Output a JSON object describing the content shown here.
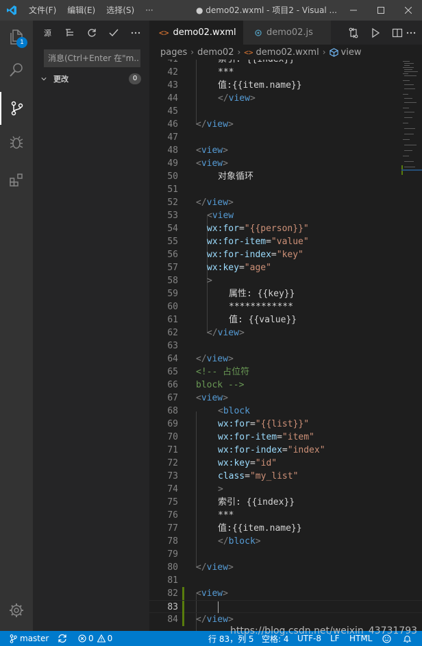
{
  "titlebar": {
    "menu": [
      "文件(F)",
      "编辑(E)",
      "选择(S)",
      "···"
    ],
    "window_title": "● demo02.wxml - 项目2 - Visual ..."
  },
  "activity_bar": {
    "items": [
      {
        "name": "explorer",
        "icon": "files-icon",
        "badge": "1"
      },
      {
        "name": "search",
        "icon": "search-icon"
      },
      {
        "name": "source-control",
        "icon": "source-control-icon",
        "active": true
      },
      {
        "name": "debug",
        "icon": "debug-icon"
      },
      {
        "name": "extensions",
        "icon": "extensions-icon"
      }
    ],
    "bottom": {
      "name": "manage",
      "icon": "gear-icon"
    }
  },
  "sidebar": {
    "title": "源",
    "actions": [
      "list-tree-icon",
      "refresh-icon",
      "check-icon",
      "more-icon"
    ],
    "message_placeholder": "消息(Ctrl+Enter 在\"m...",
    "changes_label": "更改",
    "changes_count": "0"
  },
  "tabs": [
    {
      "label": "demo02.wxml",
      "icon_text": "<>",
      "icon_color": "#e37933",
      "active": true,
      "dirty": true
    },
    {
      "label": "demo02.js",
      "icon_text": "JS",
      "icon_color": "#519aba",
      "active": false
    }
  ],
  "editor_actions": [
    "compare-icon",
    "run-icon",
    "split-editor-icon",
    "more-icon"
  ],
  "breadcrumb": [
    "pages",
    "demo02",
    "demo02.wxml",
    "view"
  ],
  "code_lines": [
    {
      "n": "41",
      "indent": 2,
      "tokens": [
        {
          "c": "t-txt",
          "t": "索引: {{index}}"
        }
      ]
    },
    {
      "n": "42",
      "indent": 2,
      "tokens": [
        {
          "c": "t-txt",
          "t": "***"
        }
      ]
    },
    {
      "n": "43",
      "indent": 2,
      "tokens": [
        {
          "c": "t-txt",
          "t": "值:{{item.name}}"
        }
      ]
    },
    {
      "n": "44",
      "indent": 2,
      "tokens": [
        {
          "c": "t-tag2",
          "t": "</"
        },
        {
          "c": "t-tag",
          "t": "view"
        },
        {
          "c": "t-tag2",
          "t": ">"
        }
      ]
    },
    {
      "n": "45",
      "indent": 0,
      "tokens": []
    },
    {
      "n": "46",
      "indent": 0,
      "tokens": [
        {
          "c": "t-tag2",
          "t": "</"
        },
        {
          "c": "t-tag",
          "t": "view"
        },
        {
          "c": "t-tag2",
          "t": ">"
        }
      ]
    },
    {
      "n": "47",
      "indent": 0,
      "tokens": []
    },
    {
      "n": "48",
      "indent": 0,
      "tokens": [
        {
          "c": "t-tag2",
          "t": "<"
        },
        {
          "c": "t-tag",
          "t": "view"
        },
        {
          "c": "t-tag2",
          "t": ">"
        }
      ]
    },
    {
      "n": "49",
      "indent": 0,
      "tokens": [
        {
          "c": "t-tag2",
          "t": "<"
        },
        {
          "c": "t-tag",
          "t": "view"
        },
        {
          "c": "t-tag2",
          "t": ">"
        }
      ]
    },
    {
      "n": "50",
      "indent": 2,
      "tokens": [
        {
          "c": "t-txt",
          "t": "对象循环"
        }
      ]
    },
    {
      "n": "51",
      "indent": 0,
      "tokens": []
    },
    {
      "n": "52",
      "indent": 0,
      "tokens": [
        {
          "c": "t-tag2",
          "t": "</"
        },
        {
          "c": "t-tag",
          "t": "view"
        },
        {
          "c": "t-tag2",
          "t": ">"
        }
      ]
    },
    {
      "n": "53",
      "indent": 1,
      "tokens": [
        {
          "c": "t-tag2",
          "t": "<"
        },
        {
          "c": "t-tag",
          "t": "view"
        }
      ]
    },
    {
      "n": "54",
      "indent": 1,
      "tokens": [
        {
          "c": "t-attr",
          "t": "wx:for"
        },
        {
          "c": "t-txt",
          "t": "="
        },
        {
          "c": "t-str",
          "t": "\"{{person}}\""
        }
      ]
    },
    {
      "n": "55",
      "indent": 1,
      "tokens": [
        {
          "c": "t-attr",
          "t": "wx:for-item"
        },
        {
          "c": "t-txt",
          "t": "="
        },
        {
          "c": "t-str",
          "t": "\"value\""
        }
      ]
    },
    {
      "n": "56",
      "indent": 1,
      "tokens": [
        {
          "c": "t-attr",
          "t": "wx:for-index"
        },
        {
          "c": "t-txt",
          "t": "="
        },
        {
          "c": "t-str",
          "t": "\"key\""
        }
      ]
    },
    {
      "n": "57",
      "indent": 1,
      "tokens": [
        {
          "c": "t-attr",
          "t": "wx:key"
        },
        {
          "c": "t-txt",
          "t": "="
        },
        {
          "c": "t-str",
          "t": "\"age\""
        }
      ]
    },
    {
      "n": "58",
      "indent": 1,
      "tokens": [
        {
          "c": "t-tag2",
          "t": ">"
        }
      ]
    },
    {
      "n": "59",
      "indent": 3,
      "tokens": [
        {
          "c": "t-txt",
          "t": "属性: {{key}}"
        }
      ]
    },
    {
      "n": "60",
      "indent": 3,
      "tokens": [
        {
          "c": "t-txt",
          "t": "************"
        }
      ]
    },
    {
      "n": "61",
      "indent": 3,
      "tokens": [
        {
          "c": "t-txt",
          "t": "值: {{value}}"
        }
      ]
    },
    {
      "n": "62",
      "indent": 1,
      "tokens": [
        {
          "c": "t-tag2",
          "t": "</"
        },
        {
          "c": "t-tag",
          "t": "view"
        },
        {
          "c": "t-tag2",
          "t": ">"
        }
      ]
    },
    {
      "n": "63",
      "indent": 0,
      "tokens": []
    },
    {
      "n": "64",
      "indent": 0,
      "tokens": [
        {
          "c": "t-tag2",
          "t": "</"
        },
        {
          "c": "t-tag",
          "t": "view"
        },
        {
          "c": "t-tag2",
          "t": ">"
        }
      ]
    },
    {
      "n": "65",
      "indent": 0,
      "tokens": [
        {
          "c": "t-cmt",
          "t": "<!-- 占位符"
        }
      ]
    },
    {
      "n": "66",
      "indent": 0,
      "tokens": [
        {
          "c": "t-cmt",
          "t": "block -->"
        }
      ]
    },
    {
      "n": "67",
      "indent": 0,
      "tokens": [
        {
          "c": "t-tag2",
          "t": "<"
        },
        {
          "c": "t-tag",
          "t": "view"
        },
        {
          "c": "t-tag2",
          "t": ">"
        }
      ]
    },
    {
      "n": "68",
      "indent": 2,
      "tokens": [
        {
          "c": "t-tag2",
          "t": "<"
        },
        {
          "c": "t-tag",
          "t": "block"
        }
      ]
    },
    {
      "n": "69",
      "indent": 2,
      "tokens": [
        {
          "c": "t-attr",
          "t": "wx:for"
        },
        {
          "c": "t-txt",
          "t": "="
        },
        {
          "c": "t-str",
          "t": "\"{{list}}\""
        }
      ]
    },
    {
      "n": "70",
      "indent": 2,
      "tokens": [
        {
          "c": "t-attr",
          "t": "wx:for-item"
        },
        {
          "c": "t-txt",
          "t": "="
        },
        {
          "c": "t-str",
          "t": "\"item\""
        }
      ]
    },
    {
      "n": "71",
      "indent": 2,
      "tokens": [
        {
          "c": "t-attr",
          "t": "wx:for-index"
        },
        {
          "c": "t-txt",
          "t": "="
        },
        {
          "c": "t-str",
          "t": "\"index\""
        }
      ]
    },
    {
      "n": "72",
      "indent": 2,
      "tokens": [
        {
          "c": "t-attr",
          "t": "wx:key"
        },
        {
          "c": "t-txt",
          "t": "="
        },
        {
          "c": "t-str",
          "t": "\"id\""
        }
      ]
    },
    {
      "n": "73",
      "indent": 2,
      "tokens": [
        {
          "c": "t-attr",
          "t": "class"
        },
        {
          "c": "t-txt",
          "t": "="
        },
        {
          "c": "t-str",
          "t": "\"my_list\""
        }
      ]
    },
    {
      "n": "74",
      "indent": 2,
      "tokens": [
        {
          "c": "t-tag2",
          "t": ">"
        }
      ]
    },
    {
      "n": "75",
      "indent": 2,
      "tokens": [
        {
          "c": "t-txt",
          "t": "索引: {{index}}"
        }
      ]
    },
    {
      "n": "76",
      "indent": 2,
      "tokens": [
        {
          "c": "t-txt",
          "t": "***"
        }
      ]
    },
    {
      "n": "77",
      "indent": 2,
      "tokens": [
        {
          "c": "t-txt",
          "t": "值:{{item.name}}"
        }
      ]
    },
    {
      "n": "78",
      "indent": 2,
      "tokens": [
        {
          "c": "t-tag2",
          "t": "</"
        },
        {
          "c": "t-tag",
          "t": "block"
        },
        {
          "c": "t-tag2",
          "t": ">"
        }
      ]
    },
    {
      "n": "79",
      "indent": 0,
      "tokens": []
    },
    {
      "n": "80",
      "indent": 0,
      "tokens": [
        {
          "c": "t-tag2",
          "t": "</"
        },
        {
          "c": "t-tag",
          "t": "view"
        },
        {
          "c": "t-tag2",
          "t": ">"
        }
      ]
    },
    {
      "n": "81",
      "indent": 0,
      "tokens": []
    },
    {
      "n": "82",
      "indent": 0,
      "tokens": [
        {
          "c": "t-tag2",
          "t": "<"
        },
        {
          "c": "t-tag",
          "t": "view"
        },
        {
          "c": "t-tag2",
          "t": ">"
        }
      ],
      "added": true
    },
    {
      "n": "83",
      "indent": 0,
      "tokens": [],
      "added": true,
      "current": true
    },
    {
      "n": "84",
      "indent": 0,
      "tokens": [
        {
          "c": "t-tag2",
          "t": "</"
        },
        {
          "c": "t-tag",
          "t": "view"
        },
        {
          "c": "t-tag2",
          "t": ">"
        }
      ],
      "added": true
    }
  ],
  "statusbar": {
    "branch": "master",
    "errors": "0",
    "warnings": "0",
    "position": "行 83，列 5",
    "spaces": "空格: 4",
    "encoding": "UTF-8",
    "eol": "LF",
    "language": "HTML"
  },
  "watermark": "https://blog.csdn.net/weixin_43731793",
  "colors": {
    "accent": "#007acc",
    "added_gutter": "#587c0c",
    "vscode_logo": "#23a9f2"
  }
}
